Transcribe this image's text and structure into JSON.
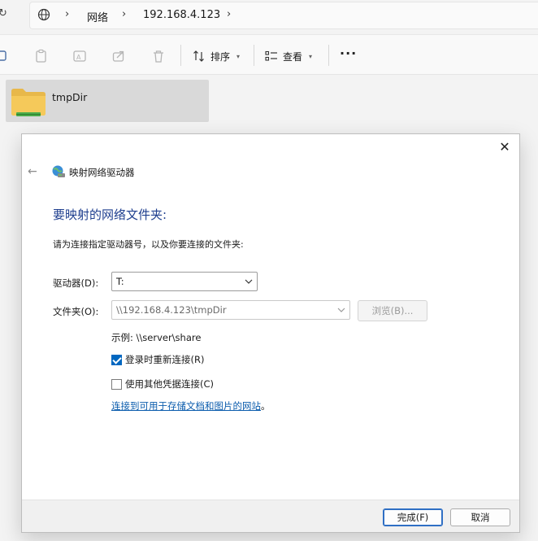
{
  "address_bar": {
    "breadcrumb": [
      "网络",
      "192.168.4.123"
    ]
  },
  "toolbar": {
    "sort_label": "排序",
    "view_label": "查看",
    "more_label": "···"
  },
  "content": {
    "items": [
      {
        "name": "tmpDir",
        "icon": "shared-folder-icon"
      }
    ]
  },
  "dialog": {
    "title": "映射网络驱动器",
    "heading": "要映射的网络文件夹:",
    "instruction": "请为连接指定驱动器号，以及你要连接的文件夹:",
    "drive_label": "驱动器(D):",
    "drive_value": "T:",
    "folder_label": "文件夹(O):",
    "folder_value": "\\\\192.168.4.123\\tmpDir",
    "browse_label": "浏览(B)...",
    "example_text": "示例: \\\\server\\share",
    "reconnect_label": "登录时重新连接(R)",
    "reconnect_checked": true,
    "other_credentials_label": "使用其他凭据连接(C)",
    "other_credentials_checked": false,
    "link_text": "连接到可用于存储文档和图片的网站",
    "link_suffix": "。",
    "finish_label": "完成(F)",
    "cancel_label": "取消"
  },
  "colors": {
    "accent": "#0067c0",
    "heading": "#1f3f8f",
    "link": "#0b5cad",
    "folder": "#e8b84a"
  }
}
